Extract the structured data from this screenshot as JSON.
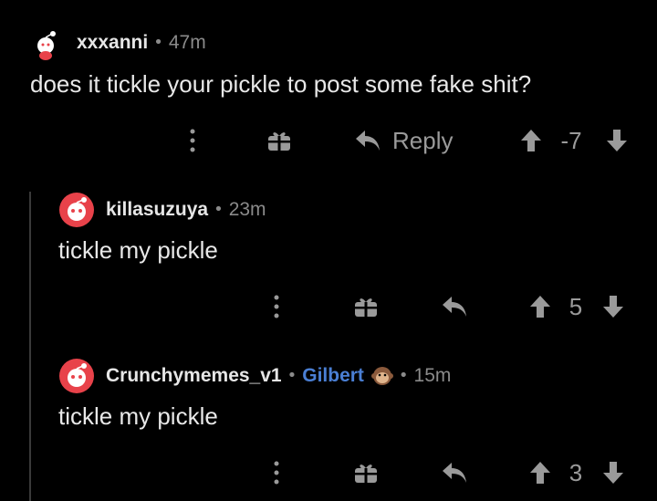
{
  "colors": {
    "background": "#000000",
    "text": "#e8e8e8",
    "muted": "#8a8a8a",
    "flair": "#4a7fd4",
    "avatar_red": "#e8424a"
  },
  "comments": [
    {
      "username": "xxxanni",
      "time": "47m",
      "body": "does it tickle your pickle to post some fake shit?",
      "reply_label": "Reply",
      "score": "-7",
      "avatar": "snoo-avatar-icon"
    },
    {
      "username": "killasuzuya",
      "time": "23m",
      "body": "tickle my pickle",
      "score": "5",
      "avatar": "snoo-avatar-icon"
    },
    {
      "username": "Crunchymemes_v1",
      "flair": "Gilbert",
      "time": "15m",
      "body": "tickle my pickle",
      "score": "3",
      "avatar": "snoo-avatar-icon"
    }
  ],
  "separator": "•"
}
